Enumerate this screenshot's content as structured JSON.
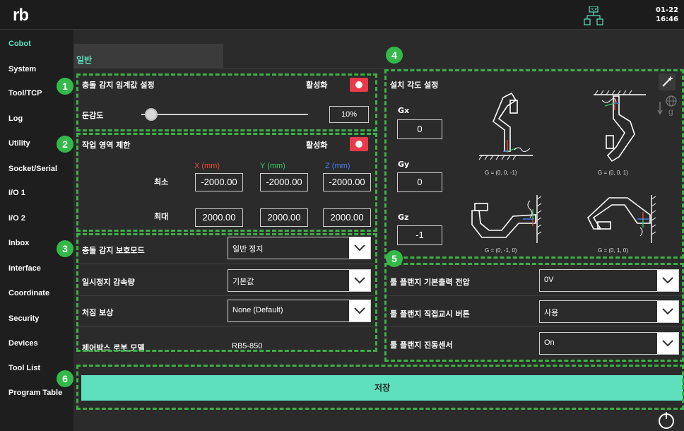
{
  "header": {
    "logo": "rb",
    "tcp_label": "TCP",
    "date": "01-22",
    "time": "16:46"
  },
  "sidebar": {
    "items": [
      {
        "label": "Cobot",
        "active": true
      },
      {
        "label": "System"
      },
      {
        "label": "Tool/TCP"
      },
      {
        "label": "Log"
      },
      {
        "label": "Utility"
      },
      {
        "label": "Socket/Serial"
      },
      {
        "label": "I/O 1"
      },
      {
        "label": "I/O 2"
      },
      {
        "label": "Inbox"
      },
      {
        "label": "Interface"
      },
      {
        "label": "Coordinate"
      },
      {
        "label": "Security"
      },
      {
        "label": "Devices"
      },
      {
        "label": "Tool List"
      },
      {
        "label": "Program Table"
      }
    ]
  },
  "tab": {
    "label": "일반"
  },
  "collision": {
    "title": "충돌 감지 임계값 설정",
    "enable_label": "활성화",
    "sensitivity_label": "둔감도",
    "sensitivity_value": "10%",
    "slider_level": 0.06
  },
  "workspace": {
    "title": "작업 영역 제한",
    "enable_label": "활성화",
    "headers": [
      "X (mm)",
      "Y (mm)",
      "Z (mm)"
    ],
    "header_colors": [
      "#e84b3c",
      "#3cc46a",
      "#4a7ce8"
    ],
    "min_label": "최소",
    "max_label": "최대",
    "min": [
      "-2000.00",
      "-2000.00",
      "-2000.00"
    ],
    "max": [
      "2000.00",
      "2000.00",
      "2000.00"
    ]
  },
  "settings_left": [
    {
      "label": "충돌 감지 보호모드",
      "value": "일반 정지",
      "type": "select"
    },
    {
      "label": "일시정지 감속량",
      "value": "기본값",
      "type": "select"
    },
    {
      "label": "처짐 보상",
      "value": "None (Default)",
      "type": "select"
    },
    {
      "label": "제어박스 로봇 모델",
      "value": "RB5-850",
      "type": "static"
    }
  ],
  "mount": {
    "title": "설치 각도 설정",
    "gx_label": "Gx",
    "gy_label": "Gy",
    "gz_label": "Gz",
    "gx": "0",
    "gy": "0",
    "gz": "-1",
    "captions": [
      "G = (0, 0, -1)",
      "G = (0, 0, 1)",
      "G = (0, -1, 0)",
      "G = (0, 1, 0)"
    ]
  },
  "flange": [
    {
      "label": "툴 플랜지 기본출력 전압",
      "value": "0V"
    },
    {
      "label": "툴 플랜지 직접교시 버튼",
      "value": "사용"
    },
    {
      "label": "툴 플랜지 진동센서",
      "value": "On"
    }
  ],
  "save_label": "저장",
  "badges": [
    "1",
    "2",
    "3",
    "4",
    "5",
    "6"
  ],
  "colors": {
    "accent": "#5ee0bd",
    "toggle": "#e83a4a",
    "annotation": "#3cb043"
  }
}
